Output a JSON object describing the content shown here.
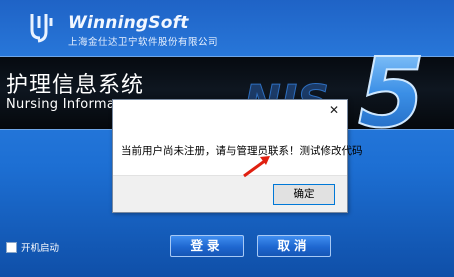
{
  "brand": {
    "name": "WinningSoft",
    "subtitle": "上海金仕达卫宁软件股份有限公司"
  },
  "banner": {
    "title": "护理信息系统",
    "subtitle": "Nursing Informa"
  },
  "dialog": {
    "message": "当前用户尚未注册，请与管理员联系！测试修改代码",
    "close_symbol": "✕",
    "ok_label": "确定"
  },
  "footer": {
    "autostart_label": "开机启动",
    "login_label": "登录",
    "cancel_label": "取消"
  },
  "colors": {
    "background": "#1f6fd3",
    "banner": "#0b1118",
    "annotation": "#e02010"
  }
}
